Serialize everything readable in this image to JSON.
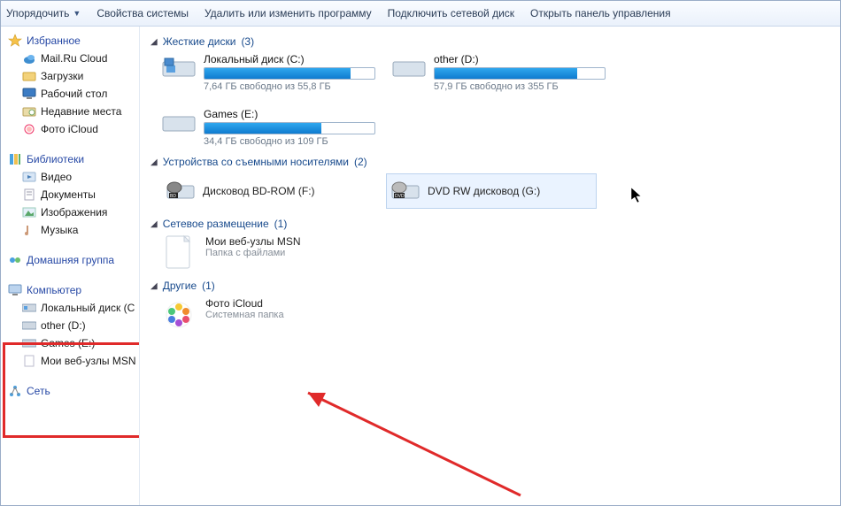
{
  "toolbar": {
    "organize": "Упорядочить",
    "system_properties": "Свойства системы",
    "uninstall": "Удалить или изменить программу",
    "map_drive": "Подключить сетевой диск",
    "control_panel": "Открыть панель управления"
  },
  "sidebar": {
    "favorites": {
      "title": "Избранное",
      "items": [
        {
          "label": "Mail.Ru Cloud"
        },
        {
          "label": "Загрузки"
        },
        {
          "label": "Рабочий стол"
        },
        {
          "label": "Недавние места"
        },
        {
          "label": "Фото iCloud"
        }
      ]
    },
    "libraries": {
      "title": "Библиотеки",
      "items": [
        {
          "label": "Видео"
        },
        {
          "label": "Документы"
        },
        {
          "label": "Изображения"
        },
        {
          "label": "Музыка"
        }
      ]
    },
    "homegroup": {
      "title": "Домашняя группа"
    },
    "computer": {
      "title": "Компьютер",
      "items": [
        {
          "label": "Локальный диск (C"
        },
        {
          "label": "other (D:)"
        },
        {
          "label": "Games (E:)"
        },
        {
          "label": "Мои веб-узлы MSN"
        }
      ]
    },
    "network": {
      "title": "Сеть"
    }
  },
  "sections": {
    "hdd": {
      "title": "Жесткие диски",
      "count": "(3)"
    },
    "removable": {
      "title": "Устройства со съемными носителями",
      "count": "(2)"
    },
    "netloc": {
      "title": "Сетевое размещение",
      "count": "(1)"
    },
    "other": {
      "title": "Другие",
      "count": "(1)"
    }
  },
  "drives": [
    {
      "name": "Локальный диск (C:)",
      "free": "7,64 ГБ свободно из 55,8 ГБ",
      "fill": 86
    },
    {
      "name": "other (D:)",
      "free": "57,9 ГБ свободно из 355 ГБ",
      "fill": 84
    },
    {
      "name": "Games (E:)",
      "free": "34,4 ГБ свободно из 109 ГБ",
      "fill": 69
    }
  ],
  "devices": [
    {
      "name": "Дисковод BD-ROM (F:)"
    },
    {
      "name": "DVD RW дисковод (G:)"
    }
  ],
  "netloc_item": {
    "name": "Мои веб-узлы MSN",
    "sub": "Папка с файлами"
  },
  "other_item": {
    "name": "Фото iCloud",
    "sub": "Системная папка"
  }
}
